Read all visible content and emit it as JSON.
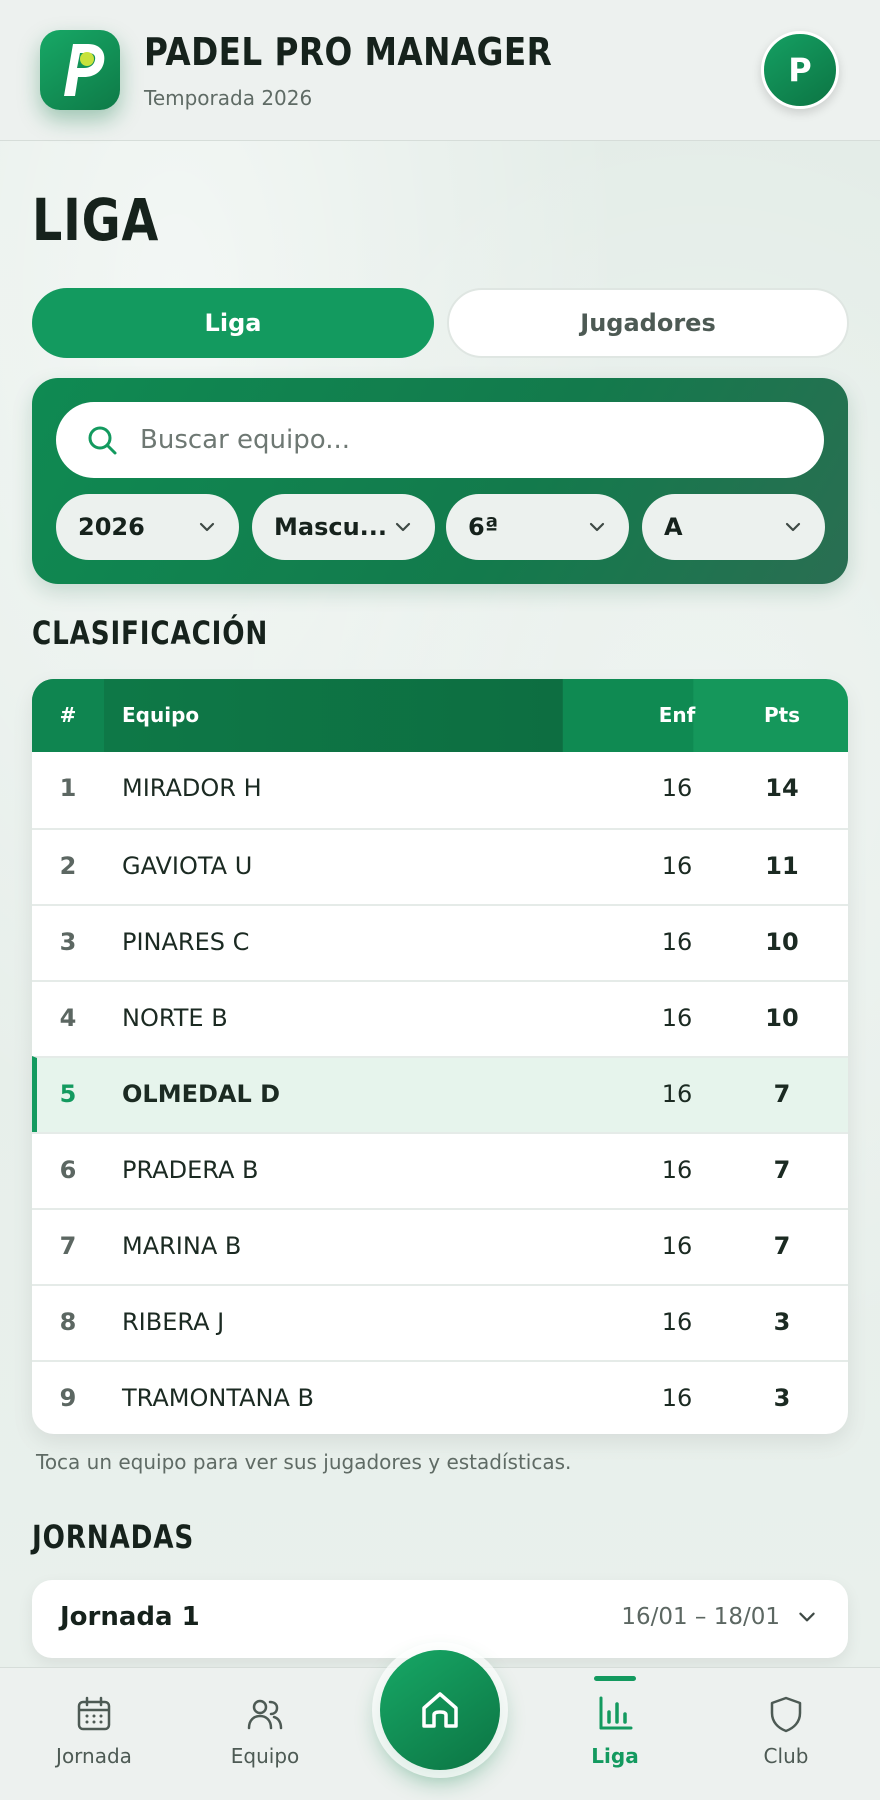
{
  "header": {
    "app_title": "PADEL PRO MANAGER",
    "subtitle": "Temporada 2026",
    "avatar_initial": "P"
  },
  "page": {
    "title": "LIGA"
  },
  "tabs": [
    {
      "label": "Liga",
      "active": true
    },
    {
      "label": "Jugadores",
      "active": false
    }
  ],
  "search": {
    "placeholder": "Buscar equipo...",
    "value": ""
  },
  "filters": [
    {
      "value": "2026"
    },
    {
      "value": "Mascu..."
    },
    {
      "value": "6ª"
    },
    {
      "value": "A"
    }
  ],
  "standings": {
    "section_title": "CLASIFICACIÓN",
    "headers": {
      "rank": "#",
      "team": "Equipo",
      "enf": "Enf",
      "pts": "Pts"
    },
    "rows": [
      {
        "rank": "1",
        "team": "MIRADOR H",
        "enf": "16",
        "pts": "14"
      },
      {
        "rank": "2",
        "team": "GAVIOTA U",
        "enf": "16",
        "pts": "11"
      },
      {
        "rank": "3",
        "team": "PINARES C",
        "enf": "16",
        "pts": "10"
      },
      {
        "rank": "4",
        "team": "NORTE B",
        "enf": "16",
        "pts": "10"
      },
      {
        "rank": "5",
        "team": "OLMEDAL D",
        "enf": "16",
        "pts": "7",
        "highlighted": true
      },
      {
        "rank": "6",
        "team": "PRADERA B",
        "enf": "16",
        "pts": "7"
      },
      {
        "rank": "7",
        "team": "MARINA B",
        "enf": "16",
        "pts": "7"
      },
      {
        "rank": "8",
        "team": "RIBERA J",
        "enf": "16",
        "pts": "3"
      },
      {
        "rank": "9",
        "team": "TRAMONTANA B",
        "enf": "16",
        "pts": "3"
      }
    ],
    "hint": "Toca un equipo para ver sus jugadores y estadísticas."
  },
  "jornadas": {
    "section_title": "JORNADAS",
    "items": [
      {
        "title": "Jornada 1",
        "dates": "16/01 – 18/01"
      }
    ]
  },
  "nav": {
    "items": [
      {
        "label": "Jornada",
        "icon": "calendar-icon"
      },
      {
        "label": "Equipo",
        "icon": "users-icon"
      },
      {
        "label": "Liga",
        "icon": "bar-chart-icon",
        "active": true
      },
      {
        "label": "Club",
        "icon": "shield-icon"
      }
    ],
    "home_icon": "home-icon"
  },
  "colors": {
    "accent": "#139a5f",
    "accent_dark": "#0e7a48",
    "highlight_row": "#e6f4ec",
    "background": "#e8efeb"
  }
}
